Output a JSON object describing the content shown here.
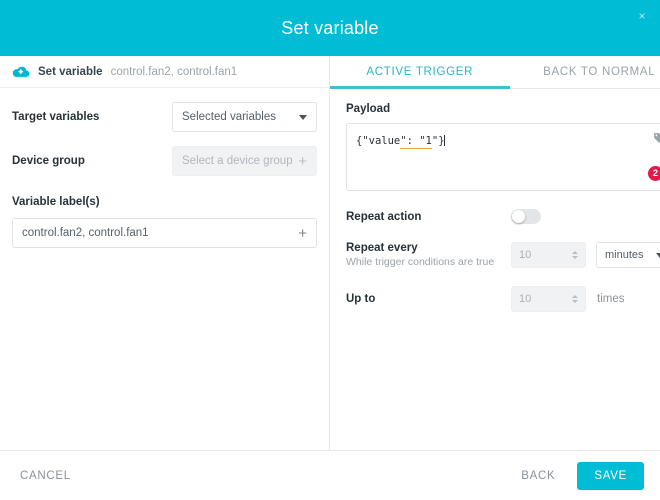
{
  "header": {
    "title": "Set variable",
    "close_label": "×",
    "bg_color": "#00bcd4"
  },
  "left_panel": {
    "breadcrumb": {
      "icon": "cloud-icon",
      "title": "Set variable",
      "subtitle": "control.fan2, control.fan1"
    },
    "target_variables": {
      "label": "Target variables",
      "value": "Selected variables",
      "icon": "chevron-down-icon"
    },
    "device_group": {
      "label": "Device group",
      "placeholder": "Select a device group",
      "value": "",
      "add_icon": "plus-icon",
      "disabled": true
    },
    "variable_labels": {
      "label": "Variable label(s)",
      "value": "control.fan2, control.fan1",
      "add_icon": "plus-icon"
    }
  },
  "right_panel": {
    "tabs": [
      {
        "label": "ACTIVE TRIGGER",
        "active": true
      },
      {
        "label": "BACK TO NORMAL",
        "active": false
      }
    ],
    "payload": {
      "label": "Payload",
      "text_prefix": "{\"value",
      "text_squiggle": "\": \"1",
      "text_suffix": "\"}",
      "tag_icon": "tag-icon",
      "error_count": "2",
      "error_color": "#e8174a"
    },
    "repeat_action": {
      "label": "Repeat action",
      "toggle_on": false
    },
    "repeat_every": {
      "label": "Repeat every",
      "sublabel": "While trigger conditions are true",
      "value": "10",
      "unit": "minutes",
      "unit_icon": "chevron-down-icon"
    },
    "up_to": {
      "label": "Up to",
      "value": "10",
      "suffix": "times"
    }
  },
  "footer": {
    "cancel_label": "CANCEL",
    "back_label": "BACK",
    "save_label": "SAVE",
    "save_color": "#00bcd4"
  }
}
